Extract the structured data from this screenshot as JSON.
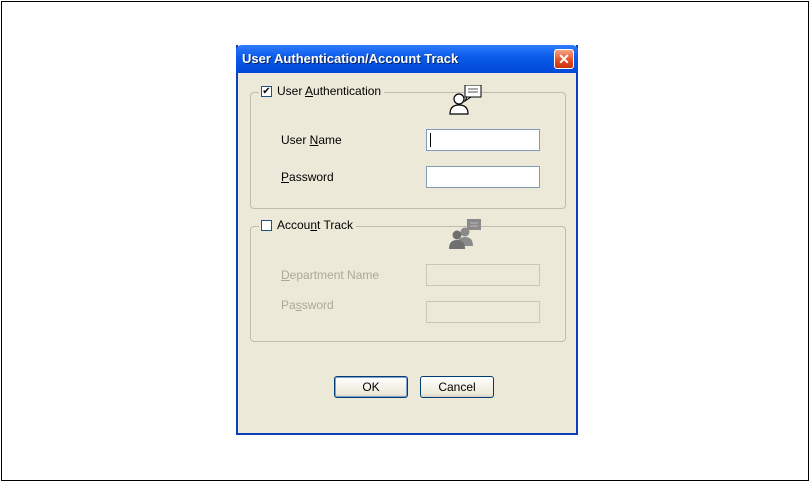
{
  "dialog": {
    "title": "User Authentication/Account Track",
    "close_label": "✕"
  },
  "user_auth": {
    "legend_prefix": "User ",
    "legend_mnemonic": "A",
    "legend_suffix": "uthentication",
    "checked": true,
    "user_name_prefix": "User ",
    "user_name_mnemonic": "N",
    "user_name_suffix": "ame",
    "user_name_value": "",
    "password_mnemonic": "P",
    "password_suffix": "assword",
    "password_value": ""
  },
  "account_track": {
    "legend_prefix": "Accou",
    "legend_mnemonic": "n",
    "legend_suffix": "t Track",
    "checked": false,
    "department_mnemonic": "D",
    "department_suffix": "epartment Name",
    "password_prefix": "Pa",
    "password_mnemonic": "s",
    "password_suffix": "sword"
  },
  "buttons": {
    "ok": "OK",
    "cancel": "Cancel"
  }
}
